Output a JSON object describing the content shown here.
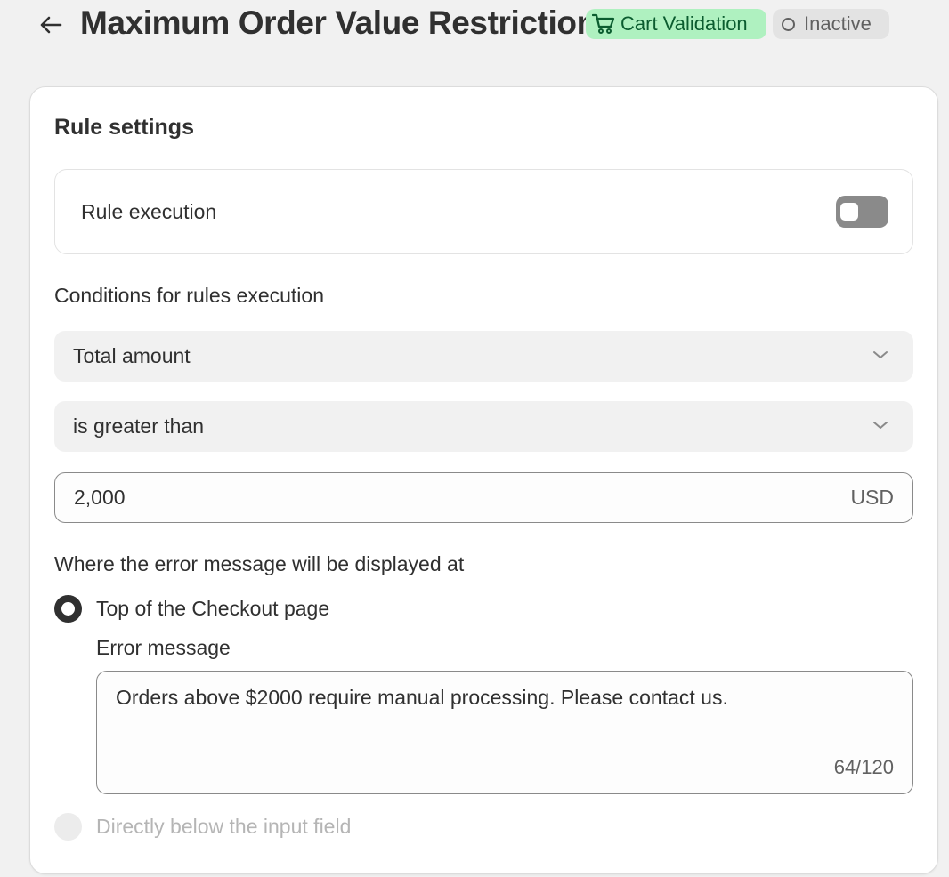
{
  "header": {
    "title": "Maximum Order Value Restriction",
    "category_badge": "Cart Validation",
    "status_badge": "Inactive",
    "back_icon": "arrow-left-icon",
    "category_icon": "cart-icon"
  },
  "colors": {
    "category_badge_bg": "#aff1c0",
    "category_badge_text": "#0b5c2f",
    "status_badge_bg": "#e3e3e3",
    "toggle_off": "#8a8a8a",
    "page_bg": "#f1f1f1"
  },
  "card": {
    "title": "Rule settings",
    "rule_execution": {
      "label": "Rule execution",
      "enabled": false
    },
    "conditions": {
      "label": "Conditions for rules execution",
      "field_select": "Total amount",
      "operator_select": "is greater than",
      "amount_value": "2,000",
      "amount_suffix": "USD"
    },
    "display": {
      "label": "Where the error message will be displayed at",
      "option_top": "Top of the Checkout page",
      "option_below": "Directly below the input field",
      "selected": "top",
      "error_label": "Error message",
      "error_text": "Orders above $2000 require manual processing. Please contact us.",
      "counter": "64/120"
    }
  }
}
